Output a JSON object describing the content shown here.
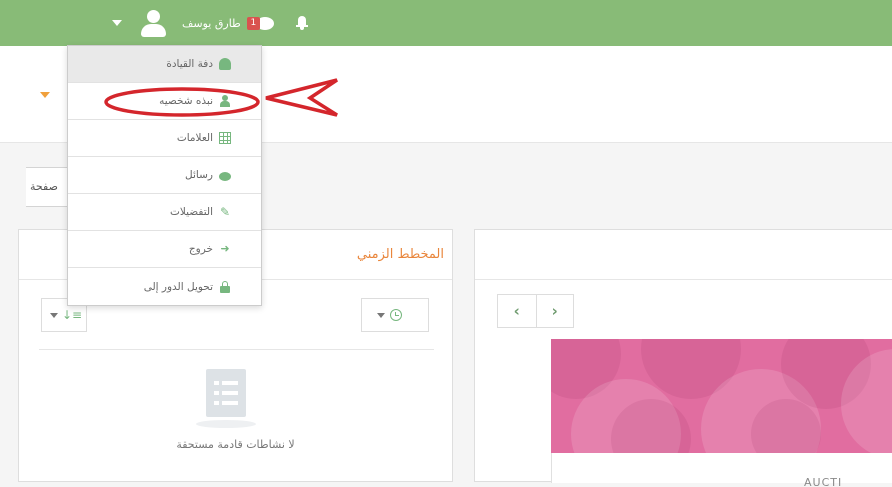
{
  "navbar": {
    "username": "طارق يوسف",
    "message_badge": "1",
    "colors": {
      "bar": "#88bb77",
      "badge": "#d9534f",
      "accent": "#e9863c"
    }
  },
  "user_menu": {
    "items": [
      {
        "label": "دفة القيادة",
        "icon": "dashboard-icon",
        "active": true
      },
      {
        "label": "نبذه شخصيه",
        "icon": "user-icon",
        "highlighted": true
      },
      {
        "label": "العلامات",
        "icon": "grades-table-icon"
      },
      {
        "label": "رسائل",
        "icon": "chat-bubble-icon"
      },
      {
        "label": "التفضيلات",
        "icon": "wrench-icon"
      },
      {
        "label": "خروج",
        "icon": "sign-out-icon"
      },
      {
        "label": "تحويل الدور إلى",
        "icon": "lock-icon"
      }
    ]
  },
  "page_button_label": "صفحة",
  "timeline": {
    "title": "المخطط الزمني",
    "empty_text": "لا نشاطات قادمة مستحقة"
  },
  "course": {
    "name_fragment": "AUCTI"
  }
}
